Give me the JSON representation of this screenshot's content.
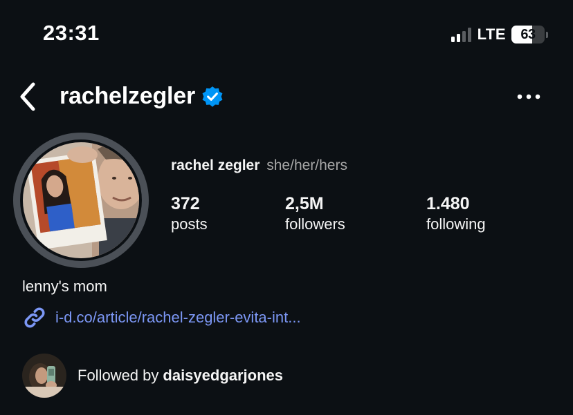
{
  "status_bar": {
    "time": "23:31",
    "network": "LTE",
    "battery_percent": "63",
    "signal_bars_active": 2,
    "signal_bars_total": 4
  },
  "header": {
    "username": "rachelzegler",
    "verified": true,
    "back_icon": "chevron-left-icon",
    "menu_icon": "more-horizontal-icon"
  },
  "profile": {
    "display_name": "rachel zegler",
    "pronouns": "she/her/hers",
    "stats": [
      {
        "value": "372",
        "label": "posts"
      },
      {
        "value": "2,5M",
        "label": "followers"
      },
      {
        "value": "1.480",
        "label": "following"
      }
    ],
    "bio": "lenny's mom",
    "link": "i-d.co/article/rachel-zegler-evita-int..."
  },
  "followed_by": {
    "prefix": "Followed by",
    "username": "daisyedgarjones"
  },
  "colors": {
    "background": "#0c1014",
    "link": "#7c97f5",
    "verified_badge": "#0095f6",
    "avatar_ring": "#4b5057",
    "secondary_text": "#a8a8a8"
  }
}
